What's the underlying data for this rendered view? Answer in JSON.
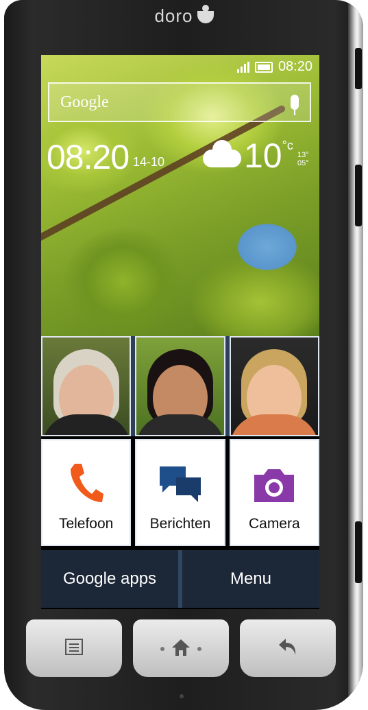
{
  "device": {
    "brand": "doro"
  },
  "status_bar": {
    "time": "08:20"
  },
  "search": {
    "label": "Google"
  },
  "widget": {
    "clock": "08:20",
    "date": "14-10",
    "temperature": "10",
    "temperature_unit": "°c",
    "temp_high": "13°",
    "temp_low": "05°"
  },
  "contacts": [
    {
      "name": "contact-1"
    },
    {
      "name": "contact-2"
    },
    {
      "name": "contact-3"
    }
  ],
  "tiles": [
    {
      "label": "Telefoon",
      "icon": "phone-icon",
      "color": "#f05a1a"
    },
    {
      "label": "Berichten",
      "icon": "messages-icon",
      "color": "#1f4f8a"
    },
    {
      "label": "Camera",
      "icon": "camera-icon",
      "color": "#8a3aa8"
    }
  ],
  "bottom_buttons": [
    {
      "label": "Google apps"
    },
    {
      "label": "Menu"
    }
  ],
  "nav_buttons": [
    {
      "icon": "menu-icon"
    },
    {
      "icon": "home-icon"
    },
    {
      "icon": "back-icon"
    }
  ]
}
